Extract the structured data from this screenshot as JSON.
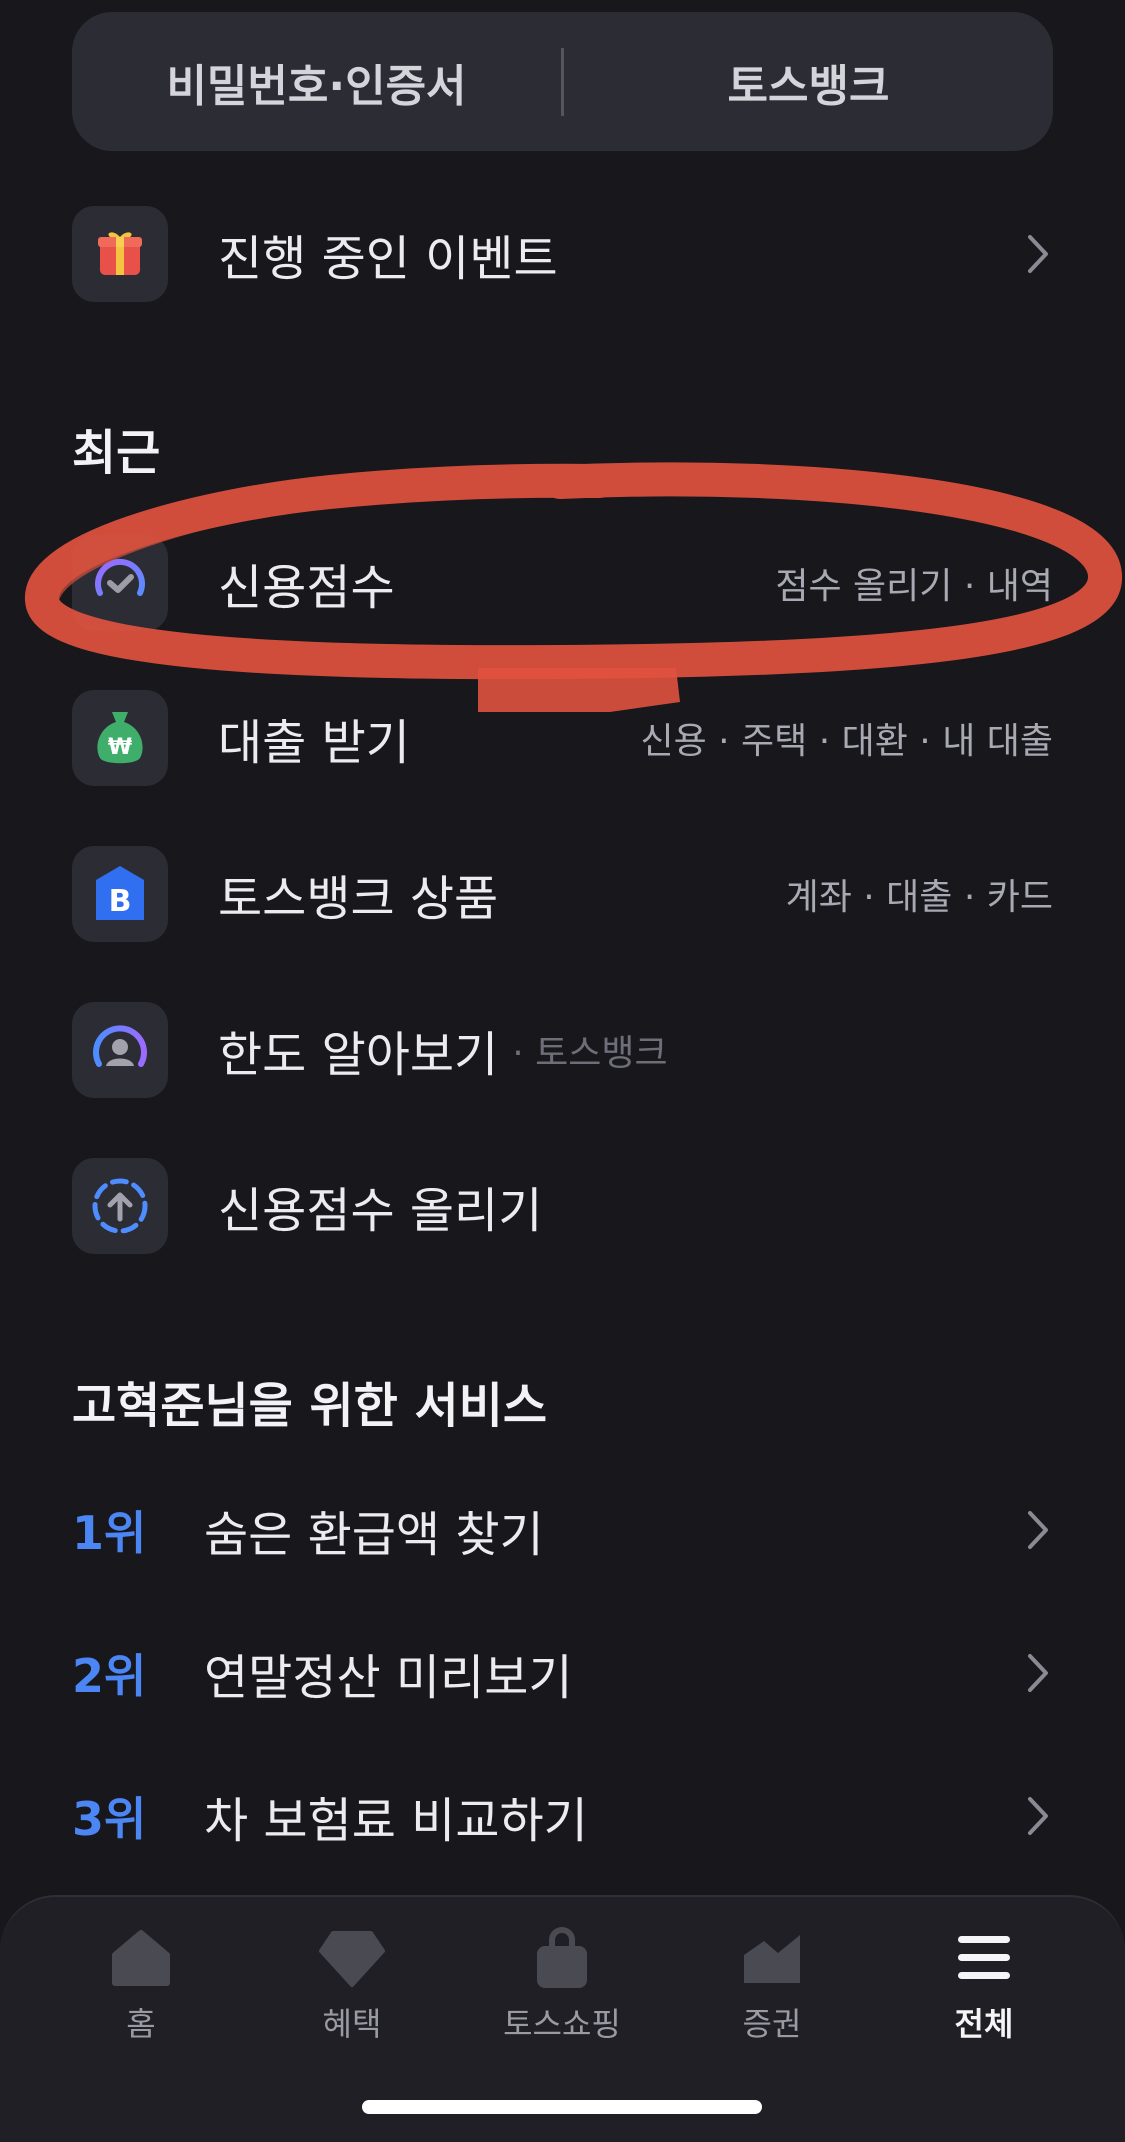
{
  "top_segment": {
    "left_label": "비밀번호·인증서",
    "right_label": "토스뱅크"
  },
  "events_row": {
    "label": "진행 중인 이벤트",
    "icon": "gift-icon"
  },
  "recent": {
    "title": "최근",
    "items": [
      {
        "label": "신용점수",
        "right": "점수 올리기 · 내역",
        "icon": "credit-score-check-icon"
      },
      {
        "label": "대출 받기",
        "right": "신용 · 주택 · 대환 · 내 대출",
        "icon": "money-bag-icon"
      },
      {
        "label": "토스뱅크 상품",
        "right": "계좌 · 대출 · 카드",
        "icon": "toss-bank-icon"
      },
      {
        "label": "한도 알아보기",
        "sub": "· 토스뱅크",
        "icon": "limit-gauge-icon"
      },
      {
        "label": "신용점수 올리기",
        "icon": "score-up-icon"
      }
    ]
  },
  "services": {
    "title": "고혁준님을 위한 서비스",
    "items": [
      {
        "rank": "1위",
        "label": "숨은 환급액 찾기"
      },
      {
        "rank": "2위",
        "label": "연말정산 미리보기"
      },
      {
        "rank": "3위",
        "label": "차 보험료 비교하기"
      }
    ]
  },
  "bottom_nav": {
    "items": [
      {
        "label": "홈",
        "icon": "home-icon"
      },
      {
        "label": "혜택",
        "icon": "gem-icon"
      },
      {
        "label": "토스쇼핑",
        "icon": "shopping-bag-icon"
      },
      {
        "label": "증권",
        "icon": "chart-icon"
      },
      {
        "label": "전체",
        "icon": "menu-icon"
      }
    ],
    "active_index": 4
  },
  "colors": {
    "background": "#17171c",
    "card": "#2c2c35",
    "accent_blue": "#4c86f5",
    "annotation_red": "#e0523f"
  }
}
